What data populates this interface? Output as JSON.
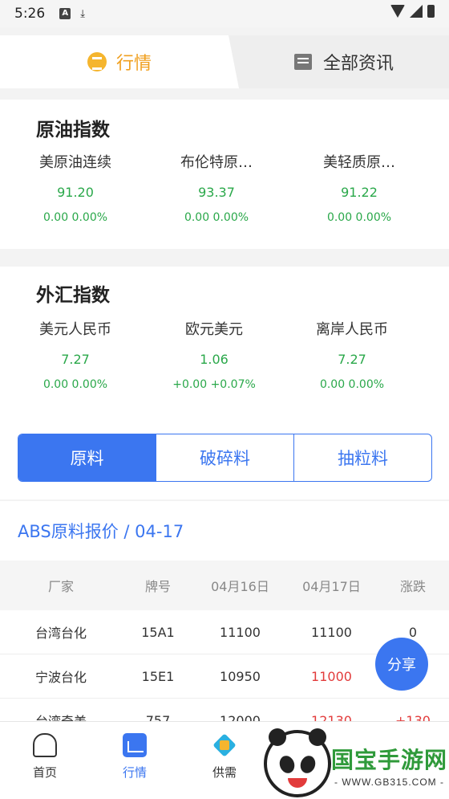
{
  "status_bar": {
    "time": "5:26",
    "icons": [
      "a-notification-icon",
      "download-icon",
      "wifi-icon",
      "signal-icon",
      "battery-icon"
    ]
  },
  "top_tabs": {
    "active": "行情",
    "inactive": "全部资讯"
  },
  "crude_oil": {
    "title": "原油指数",
    "items": [
      {
        "name": "美原油连续",
        "price": "91.20",
        "change": "0.00  0.00%"
      },
      {
        "name": "布伦特原…",
        "price": "93.37",
        "change": "0.00  0.00%"
      },
      {
        "name": "美轻质原…",
        "price": "91.22",
        "change": "0.00  0.00%"
      }
    ]
  },
  "forex": {
    "title": "外汇指数",
    "items": [
      {
        "name": "美元人民币",
        "price": "7.27",
        "change": "0.00  0.00%"
      },
      {
        "name": "欧元美元",
        "price": "1.06",
        "change": "+0.00  +0.07%"
      },
      {
        "name": "离岸人民币",
        "price": "7.27",
        "change": "0.00  0.00%"
      }
    ]
  },
  "segments": {
    "raw": "原料",
    "crushed": "破碎料",
    "pellet": "抽粒料"
  },
  "price_section": {
    "title": "ABS原料报价 / 04-17"
  },
  "table": {
    "headers": [
      "厂家",
      "牌号",
      "04月16日",
      "04月17日",
      "涨跌"
    ],
    "rows": [
      [
        "台湾台化",
        "15A1",
        "11100",
        "11100",
        "0"
      ],
      [
        "宁波台化",
        "15E1",
        "10950",
        "11000",
        ""
      ],
      [
        "台湾奇美",
        "757",
        "12000",
        "12130",
        "+130"
      ]
    ]
  },
  "share_button": "分享",
  "bottom_nav": {
    "home": "首页",
    "market": "行情",
    "supply": "供需"
  },
  "watermark": {
    "text": "国宝手游网",
    "url": "- WWW.GB315.COM -"
  },
  "colors": {
    "accent": "#3b76f0",
    "up": "#e23b3b",
    "flat": "#2aa84a",
    "tab_active": "#f0a020"
  }
}
